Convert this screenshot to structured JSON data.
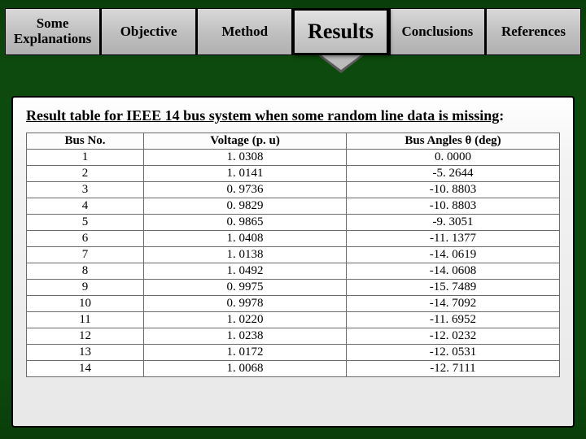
{
  "tabs": {
    "some_explanations": "Some Explanations",
    "objective": "Objective",
    "method": "Method",
    "results": "Results",
    "conclusions": "Conclusions",
    "references": "References"
  },
  "section_title_prefix": "Result table for IEEE 14 bus system when some random line data is missing",
  "section_title_suffix": ":",
  "headers": {
    "bus_no": "Bus No.",
    "voltage": "Voltage (p. u)",
    "angle": "Bus Angles θ (deg)"
  },
  "chart_data": {
    "type": "table",
    "title": "Result table for IEEE 14 bus system when some random line data is missing",
    "columns": [
      "Bus No.",
      "Voltage (p. u)",
      "Bus Angles θ (deg)"
    ],
    "rows": [
      {
        "bus": "1",
        "voltage": "1. 0308",
        "angle": "0. 0000"
      },
      {
        "bus": "2",
        "voltage": "1. 0141",
        "angle": "-5. 2644"
      },
      {
        "bus": "3",
        "voltage": "0. 9736",
        "angle": "-10. 8803"
      },
      {
        "bus": "4",
        "voltage": "0. 9829",
        "angle": "-10. 8803"
      },
      {
        "bus": "5",
        "voltage": "0. 9865",
        "angle": "-9. 3051"
      },
      {
        "bus": "6",
        "voltage": "1. 0408",
        "angle": "-11. 1377"
      },
      {
        "bus": "7",
        "voltage": "1. 0138",
        "angle": "-14. 0619"
      },
      {
        "bus": "8",
        "voltage": "1. 0492",
        "angle": "-14. 0608"
      },
      {
        "bus": "9",
        "voltage": "0. 9975",
        "angle": "-15. 7489"
      },
      {
        "bus": "10",
        "voltage": "0. 9978",
        "angle": "-14. 7092"
      },
      {
        "bus": "11",
        "voltage": "1. 0220",
        "angle": "-11. 6952"
      },
      {
        "bus": "12",
        "voltage": "1. 0238",
        "angle": "-12. 0232"
      },
      {
        "bus": "13",
        "voltage": "1. 0172",
        "angle": "-12. 0531"
      },
      {
        "bus": "14",
        "voltage": "1. 0068",
        "angle": "-12. 7111"
      }
    ]
  }
}
